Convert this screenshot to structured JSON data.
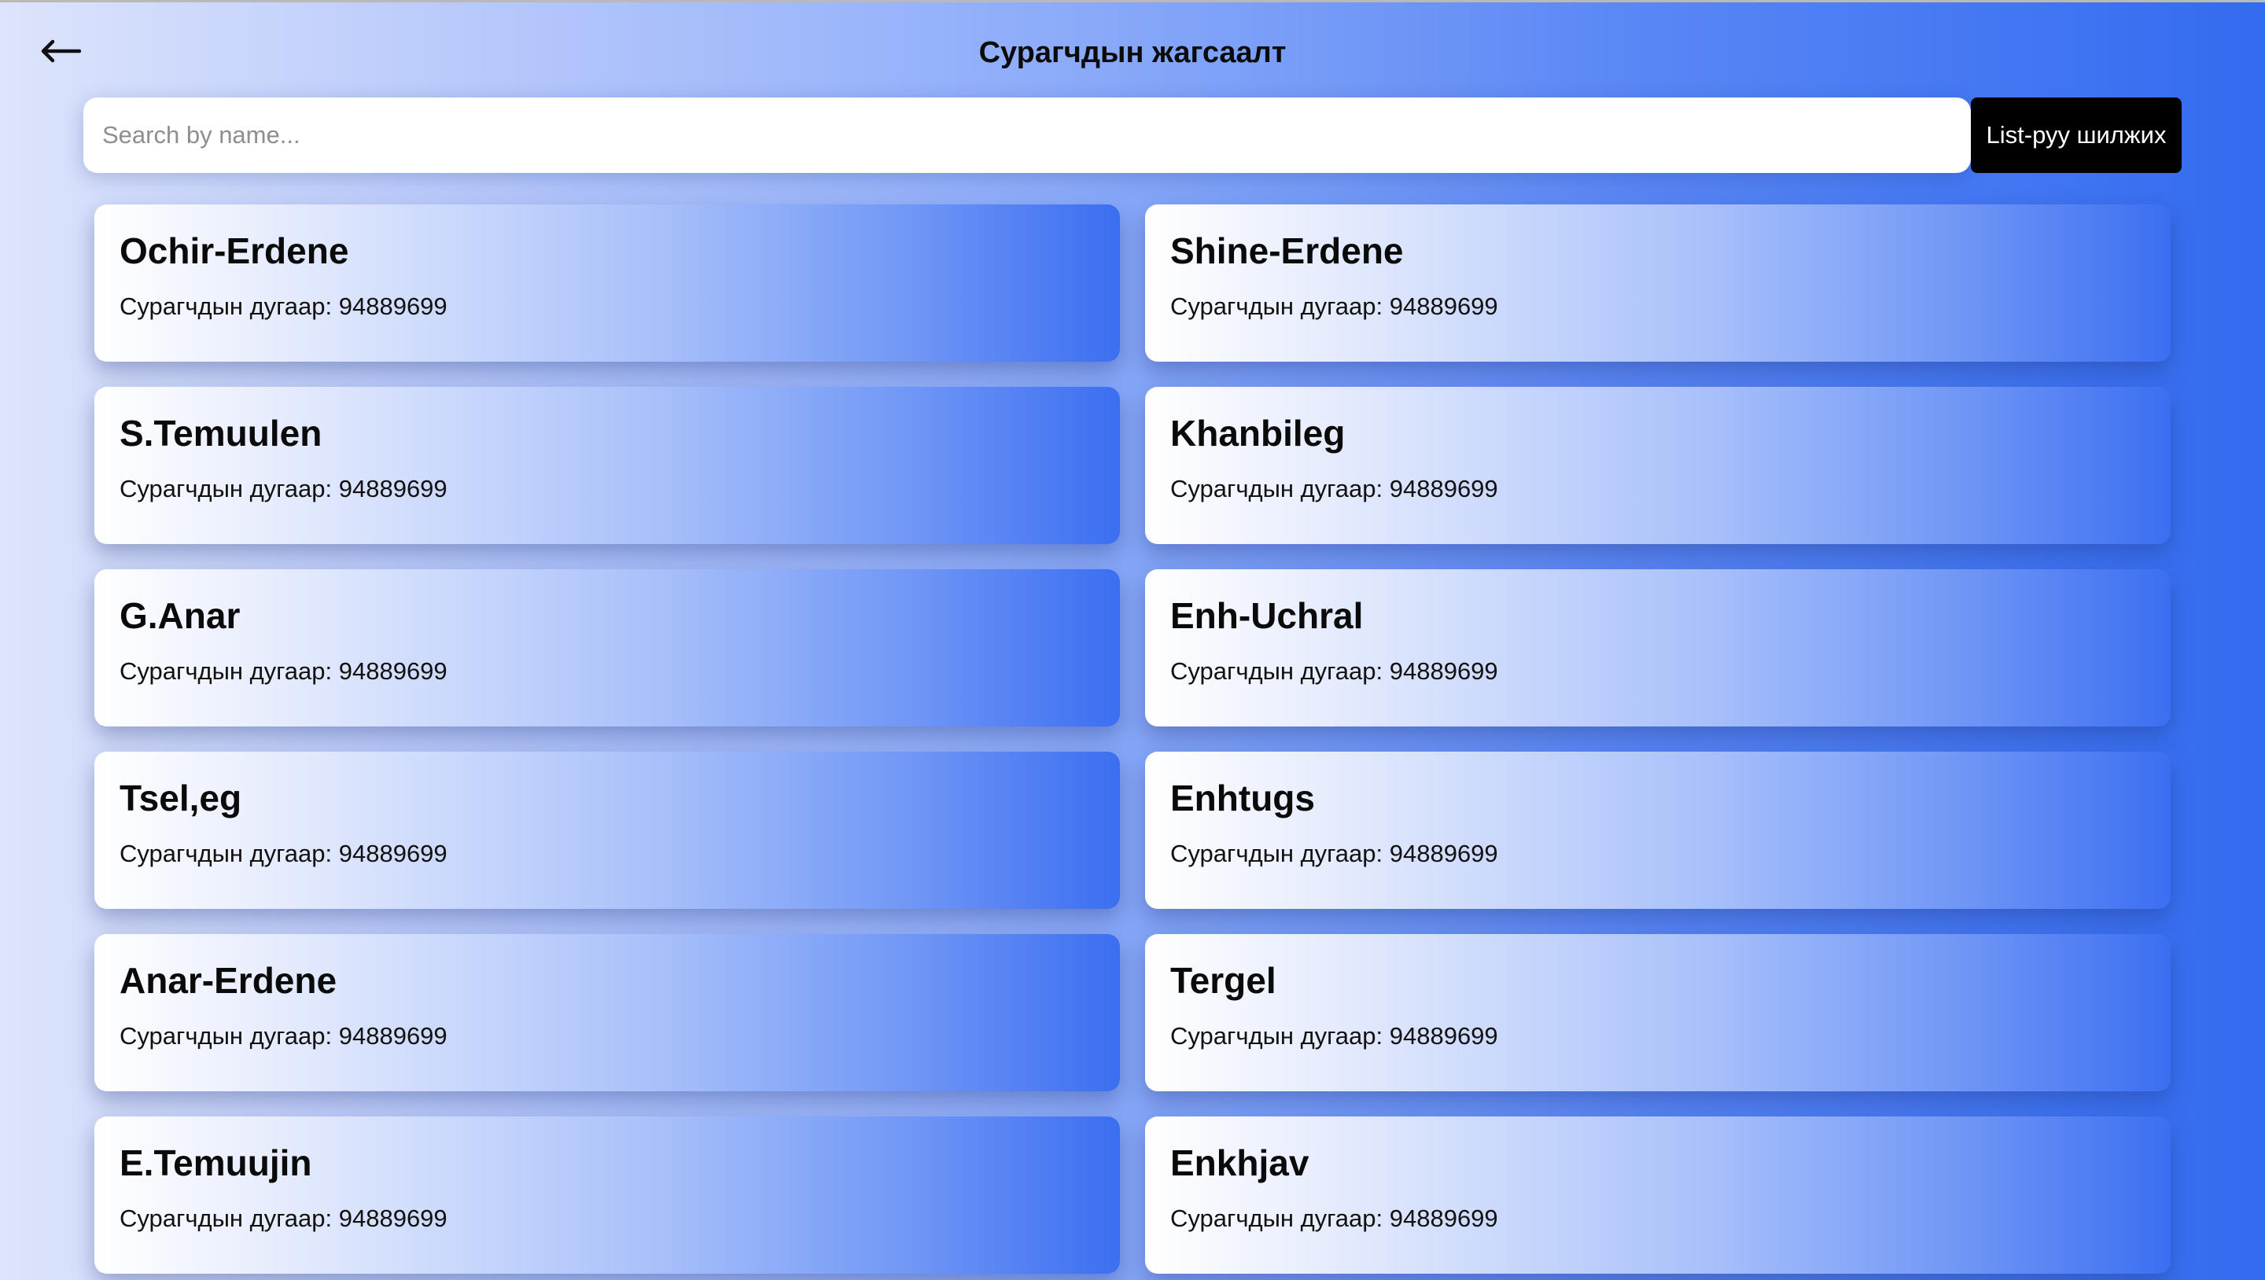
{
  "header": {
    "title": "Сурагчдын жагсаалт",
    "back_icon": "arrow-left-icon"
  },
  "search": {
    "placeholder": "Search by name...",
    "value": "",
    "button_label": "List-руу шилжих"
  },
  "students": [
    {
      "name": "Ochir-Erdene",
      "phone_label": "Сурагчдын дугаар: 94889699"
    },
    {
      "name": "Shine-Erdene",
      "phone_label": "Сурагчдын дугаар: 94889699"
    },
    {
      "name": "S.Temuulen",
      "phone_label": "Сурагчдын дугаар: 94889699"
    },
    {
      "name": "Khanbileg",
      "phone_label": "Сурагчдын дугаар: 94889699"
    },
    {
      "name": "G.Anar",
      "phone_label": "Сурагчдын дугаар: 94889699"
    },
    {
      "name": "Enh-Uchral",
      "phone_label": "Сурагчдын дугаар: 94889699"
    },
    {
      "name": "Tsel,eg",
      "phone_label": "Сурагчдын дугаар: 94889699"
    },
    {
      "name": "Enhtugs",
      "phone_label": "Сурагчдын дугаар: 94889699"
    },
    {
      "name": "Anar-Erdene",
      "phone_label": "Сурагчдын дугаар: 94889699"
    },
    {
      "name": "Tergel",
      "phone_label": "Сурагчдын дугаар: 94889699"
    },
    {
      "name": "E.Temuujin",
      "phone_label": "Сурагчдын дугаар: 94889699"
    },
    {
      "name": "Enkhjav",
      "phone_label": "Сурагчдын дугаар: 94889699"
    }
  ],
  "colors": {
    "accent_blue": "#336bf0",
    "button_bg": "#000000",
    "button_text": "#ffffff"
  }
}
